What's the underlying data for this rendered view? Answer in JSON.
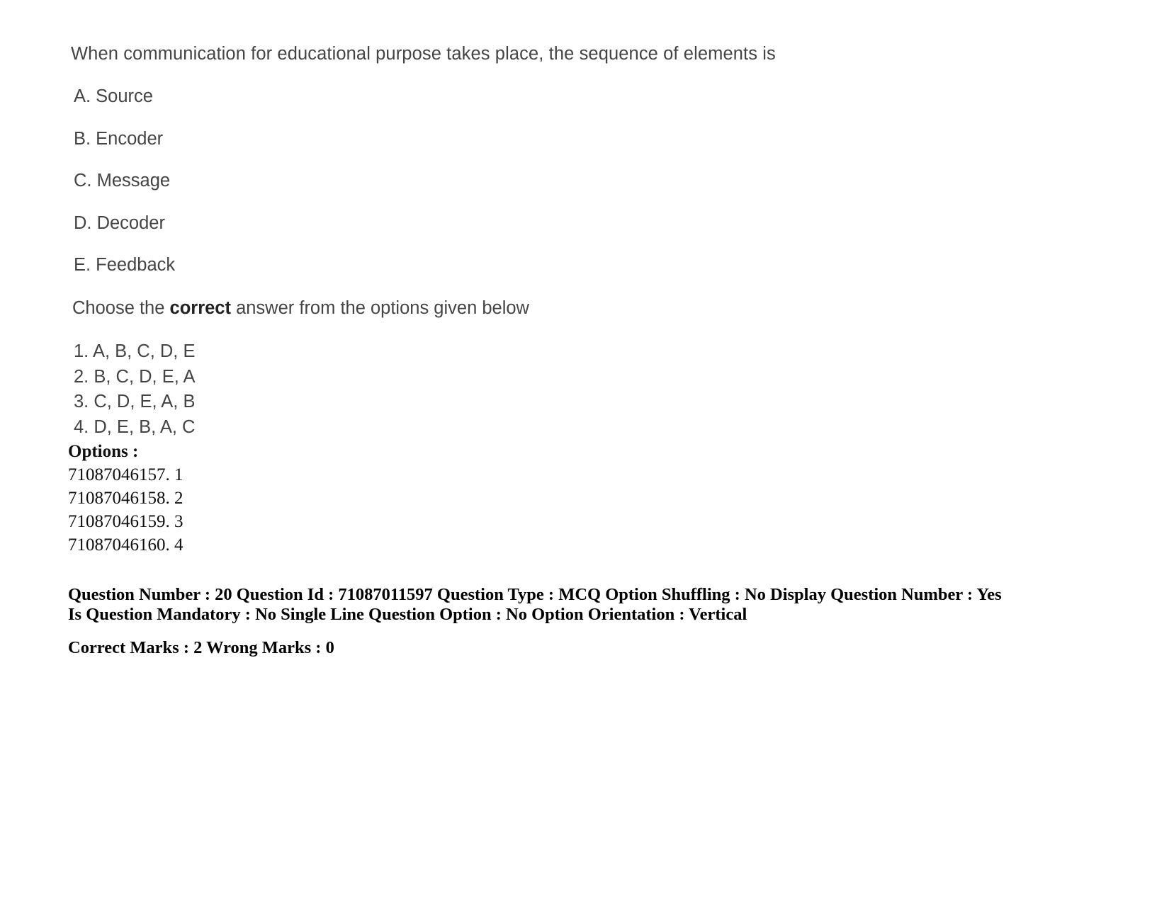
{
  "question": {
    "stem": "When communication for educational purpose takes place, the sequence of elements is",
    "statements": [
      "A. Source",
      "B. Encoder",
      "C. Message",
      "D. Decoder",
      "E. Feedback"
    ],
    "instruction": {
      "before": "Choose the ",
      "emphasis": "correct",
      "after": " answer from the options given below"
    },
    "choices": [
      "1. A, B, C, D, E",
      "2. B, C, D, E, A",
      "3. C, D, E, A, B",
      "4. D, E, B, A, C"
    ]
  },
  "options": {
    "title": "Options :",
    "items": [
      "71087046157. 1",
      "71087046158. 2",
      "71087046159. 3",
      "71087046160. 4"
    ]
  },
  "metadata": {
    "line1": "Question Number : 20 Question Id : 71087011597 Question Type : MCQ Option Shuffling : No Display Question Number : Yes Is Question Mandatory : No Single Line Question Option : No Option Orientation : Vertical",
    "marks": "Correct Marks : 2 Wrong Marks : 0"
  },
  "colors": {
    "page_background": "#ffffff",
    "body_text": "#444444",
    "meta_text": "#000000",
    "options_text": "#101010"
  }
}
